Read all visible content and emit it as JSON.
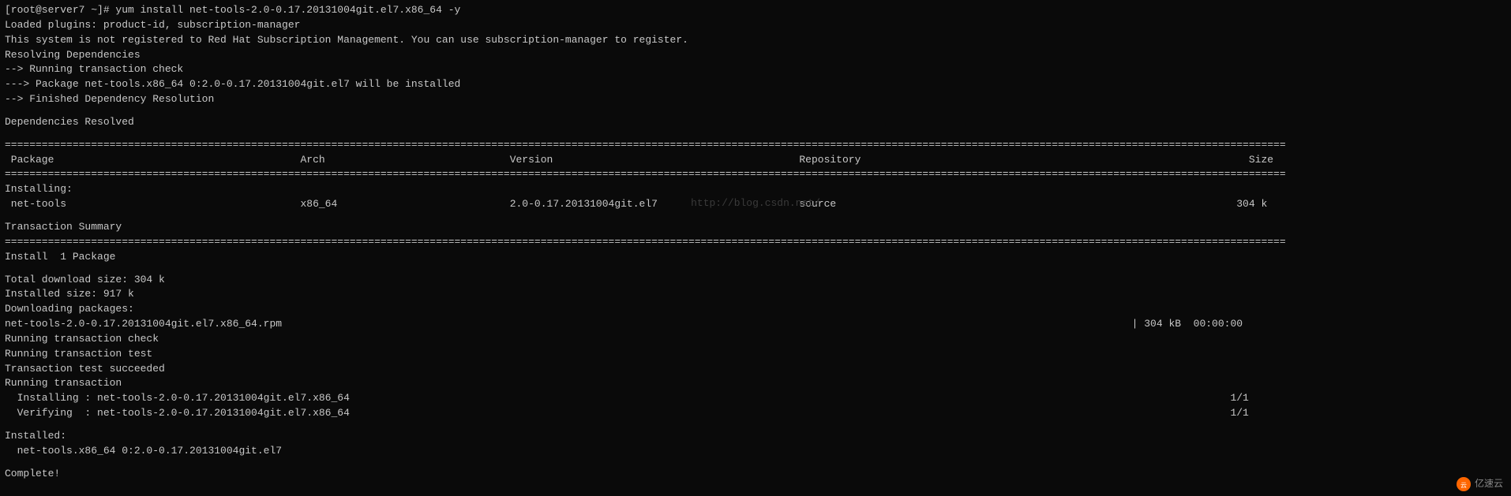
{
  "terminal": {
    "lines": [
      "[root@server7 ~]# yum install net-tools-2.0-0.17.20131004git.el7.x86_64 -y",
      "Loaded plugins: product-id, subscription-manager",
      "This system is not registered to Red Hat Subscription Management. You can use subscription-manager to register.",
      "Resolving Dependencies",
      "--> Running transaction check",
      "---> Package net-tools.x86_64 0:2.0-0.17.20131004git.el7 will be installed",
      "--> Finished Dependency Resolution",
      "",
      "Dependencies Resolved",
      "",
      "================================================================================================================================================================================================================",
      " Package                                        Arch                              Version                                        Repository                                                               Size",
      "================================================================================================================================================================================================================",
      "Installing:",
      " net-tools                                      x86_64                            2.0-0.17.20131004git.el7                       source                                                                 304 k",
      "",
      "Transaction Summary",
      "================================================================================================================================================================================================================",
      "Install  1 Package",
      "",
      "Total download size: 304 k",
      "Installed size: 917 k",
      "Downloading packages:",
      "net-tools-2.0-0.17.20131004git.el7.x86_64.rpm                                                                                                                                          | 304 kB  00:00:00",
      "Running transaction check",
      "Running transaction test",
      "Transaction test succeeded",
      "Running transaction",
      "  Installing : net-tools-2.0-0.17.20131004git.el7.x86_64                                                                                                                                               1/1",
      "  Verifying  : net-tools-2.0-0.17.20131004git.el7.x86_64                                                                                                                                               1/1",
      "",
      "Installed:",
      "  net-tools.x86_64 0:2.0-0.17.20131004git.el7",
      "",
      "Complete!"
    ],
    "watermark": "http://blog.csdn.net/",
    "logo": "亿速云"
  }
}
